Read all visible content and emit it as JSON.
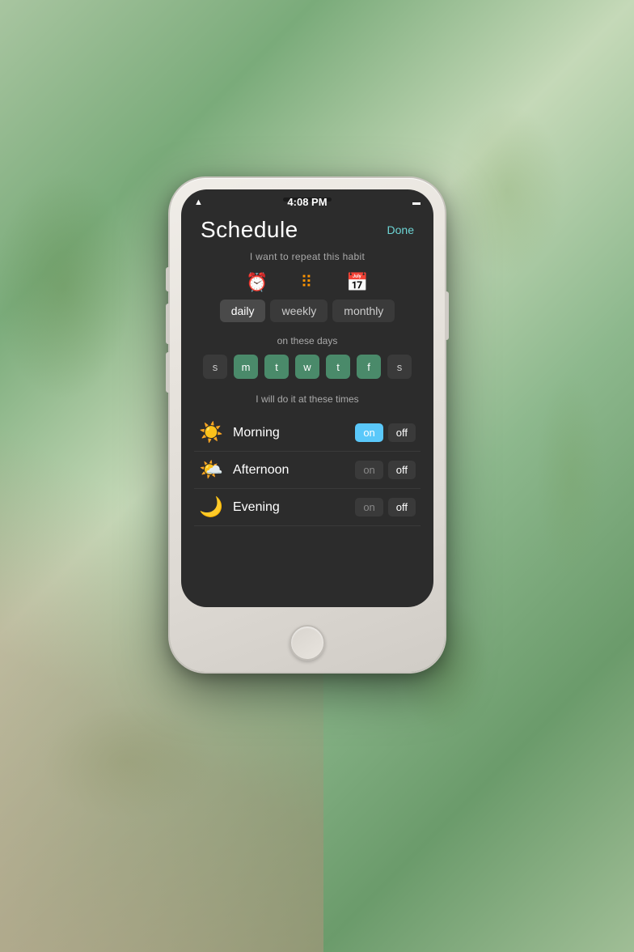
{
  "background": {
    "color": "#7aab7a"
  },
  "status_bar": {
    "time": "4:08 PM",
    "wifi": "📶",
    "battery": "🔋"
  },
  "header": {
    "title": "Schedule",
    "done_button": "Done"
  },
  "frequency": {
    "heading": "I want to repeat this habit",
    "icons": [
      {
        "name": "clock",
        "symbol": "🕐",
        "type": "clock"
      },
      {
        "name": "dots",
        "symbol": "⠿",
        "type": "dots"
      },
      {
        "name": "calendar",
        "symbol": "📅",
        "type": "calendar"
      }
    ],
    "buttons": [
      {
        "label": "daily",
        "active": true
      },
      {
        "label": "weekly",
        "active": false
      },
      {
        "label": "monthly",
        "active": false
      }
    ]
  },
  "days": {
    "heading": "on these days",
    "items": [
      {
        "label": "s",
        "active": false
      },
      {
        "label": "m",
        "active": true
      },
      {
        "label": "t",
        "active": true
      },
      {
        "label": "w",
        "active": true
      },
      {
        "label": "t",
        "active": true
      },
      {
        "label": "f",
        "active": true
      },
      {
        "label": "s",
        "active": false
      }
    ]
  },
  "times": {
    "heading": "I will do it at these times",
    "items": [
      {
        "emoji": "☀️",
        "label": "Morning",
        "on_active": true,
        "off_active": false
      },
      {
        "emoji": "🌤️",
        "label": "Afternoon",
        "on_active": false,
        "off_active": true
      },
      {
        "emoji": "🌙",
        "label": "Evening",
        "on_active": false,
        "off_active": true
      }
    ]
  }
}
